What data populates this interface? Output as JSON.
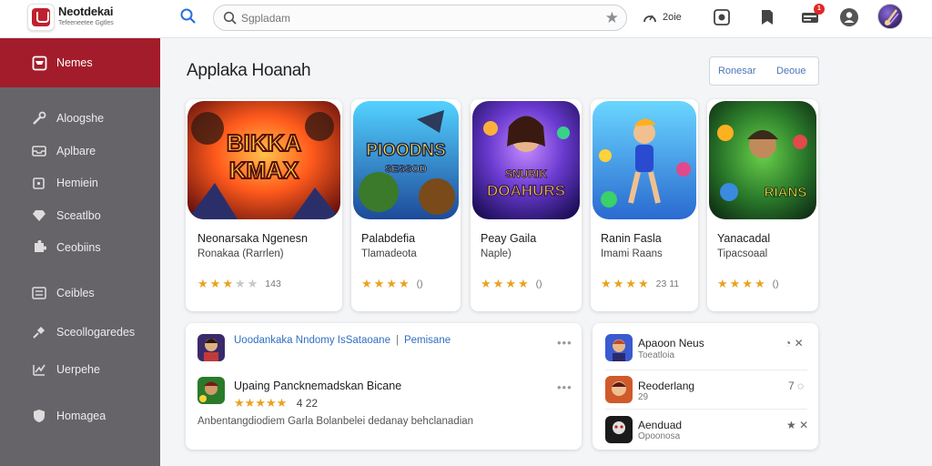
{
  "header": {
    "app_name": "Neotdekai",
    "app_tagline": "Tefeeneetee Ggtles",
    "search_placeholder": "Sgpladam",
    "speed_label": "2oie",
    "notification_count": "1"
  },
  "sidebar": {
    "items": [
      {
        "label": "Nemes",
        "icon": "store-icon",
        "active": true
      },
      {
        "label": "Aloogshe",
        "icon": "wrench-icon"
      },
      {
        "label": "Aplbare",
        "icon": "inbox-icon"
      },
      {
        "label": "Hemiein",
        "icon": "tag-icon"
      },
      {
        "label": "Sceatlbo",
        "icon": "diamond-icon"
      },
      {
        "label": "Ceobiins",
        "icon": "puzzle-icon"
      },
      {
        "label": "Ceibles",
        "icon": "list-icon"
      },
      {
        "label": "Sceollogaredes",
        "icon": "pin-icon"
      },
      {
        "label": "Uerpehe",
        "icon": "chart-icon"
      },
      {
        "label": "Homagea",
        "icon": "shield-icon"
      }
    ]
  },
  "main": {
    "title": "Applaka Hoanah",
    "filter_buttons": [
      "Ronesar",
      "Deoue"
    ],
    "cards": [
      {
        "title": "Neonarsaka Ngenesn",
        "subtitle": "Ronakaa (Rarrlen)",
        "stars": 3,
        "rating_text": "143",
        "art_text": [
          "BIKKA",
          "KMAX"
        ],
        "colors": [
          "#ff6a1c",
          "#8a1410"
        ]
      },
      {
        "title": "Palabdefia",
        "subtitle": "Tlamadeota",
        "stars": 4,
        "rating_text": "()",
        "art_text": [
          "PIOODNS",
          "SESSOD"
        ],
        "colors": [
          "#3fb8ff",
          "#1d4a9a"
        ]
      },
      {
        "title": "Peay Gaila",
        "subtitle": "Naple)",
        "stars": 4,
        "rating_text": "()",
        "art_text": [
          "SNURIK",
          "DOAHURS"
        ],
        "colors": [
          "#8a52e0",
          "#2a1470"
        ]
      },
      {
        "title": "Ranin Fasla",
        "subtitle": "Imami Raans",
        "stars": 4,
        "rating_text": "23 11",
        "art_text": [],
        "colors": [
          "#45c9e6",
          "#2a6ad0"
        ]
      },
      {
        "title": "Yanacadal",
        "subtitle": "Tipacsoaal",
        "stars": 4,
        "rating_text": "()",
        "art_text": [
          "RIANS"
        ],
        "colors": [
          "#48a83a",
          "#123a20"
        ]
      }
    ],
    "feed": {
      "link_1": "Uoodankaka Nndomy IsSataoane",
      "link_2": "Pemisane",
      "item_title": "Upaing Pancknemadskan Bicane",
      "item_rating": "4  22",
      "description": "Anbentangdiodiem Garla Bolanbelei dedanay behclanadian"
    },
    "side_list": [
      {
        "title": "Apaoon Neus",
        "subtitle": "Toeatloia",
        "actions": "◔ ✕"
      },
      {
        "title": "Reoderlang",
        "subtitle": "29",
        "actions": "7 ◌"
      },
      {
        "title": "Aenduad",
        "subtitle": "Opoonosa",
        "actions": "★ ✕"
      }
    ]
  },
  "colors": {
    "accent": "#a31c2b",
    "sidebar_bg": "#666468",
    "star": "#e9a21e",
    "link": "#2f6fc4"
  }
}
